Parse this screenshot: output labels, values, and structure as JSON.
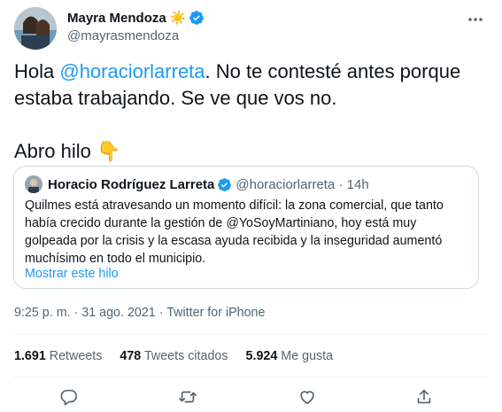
{
  "author": {
    "name": "Mayra Mendoza",
    "emoji": "☀️",
    "handle": "@mayrasmendoza"
  },
  "tweet": {
    "prefix": "Hola ",
    "mention": "@horaciorlarreta",
    "rest": ". No te contesté antes porque estaba trabajando. Se ve que vos no.",
    "second_line": "Abro hilo 👇"
  },
  "quote": {
    "name": "Horacio Rodríguez Larreta",
    "meta": "@horaciorlarreta · 14h",
    "body": "Quilmes está atravesando un momento difícil: la zona comercial, que tanto había crecido durante la gestión de @YoSoyMartiniano, hoy está muy golpeada por la crisis y la escasa ayuda recibida y la inseguridad aumentó muchísimo en todo el municipio.",
    "show_thread": "Mostrar este hilo"
  },
  "timestamp": "9:25 p. m. · 31 ago. 2021 · Twitter for iPhone",
  "stats": {
    "retweets_count": "1.691",
    "retweets_label": "Retweets",
    "quotes_count": "478",
    "quotes_label": "Tweets citados",
    "likes_count": "5.924",
    "likes_label": "Me gusta"
  },
  "icons": {
    "more": "more-icon",
    "reply": "reply-icon",
    "retweet": "retweet-icon",
    "like": "like-icon",
    "share": "share-icon",
    "verified": "verified-badge-icon"
  },
  "colors": {
    "accent": "#1d9bf0",
    "text": "#0f1419",
    "muted": "#536471",
    "border": "#cfd9de"
  }
}
